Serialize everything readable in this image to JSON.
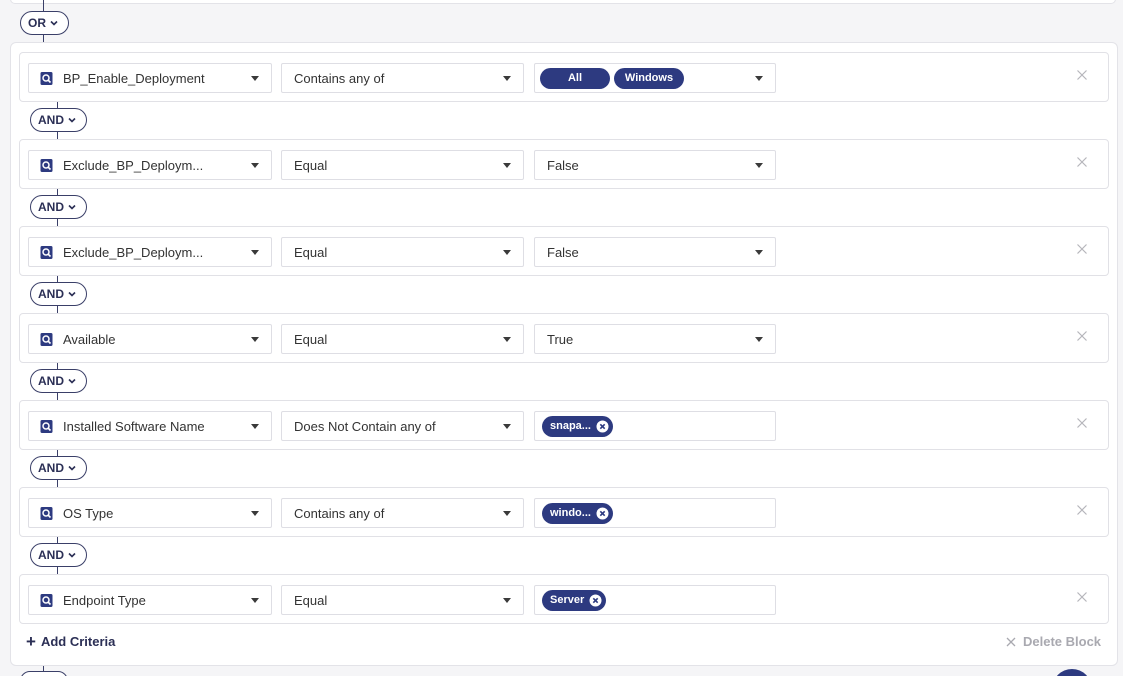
{
  "top_operator": "OR",
  "rows": [
    {
      "field": "BP_Enable_Deployment",
      "operator": "Contains any of",
      "value_type": "tags-select",
      "tags": [
        "All",
        "Windows"
      ]
    },
    {
      "join": "AND",
      "field": "Exclude_BP_Deploym...",
      "operator": "Equal",
      "value_type": "select",
      "value": "False"
    },
    {
      "join": "AND",
      "field": "Exclude_BP_Deploym...",
      "operator": "Equal",
      "value_type": "select",
      "value": "False"
    },
    {
      "join": "AND",
      "field": "Available",
      "operator": "Equal",
      "value_type": "select",
      "value": "True"
    },
    {
      "join": "AND",
      "field": "Installed Software Name",
      "operator": "Does Not Contain any of",
      "value_type": "chip",
      "chip": "snapa..."
    },
    {
      "join": "AND",
      "field": "OS Type",
      "operator": "Contains any of",
      "value_type": "chip",
      "chip": "windo..."
    },
    {
      "join": "AND",
      "field": "Endpoint Type",
      "operator": "Equal",
      "value_type": "chip",
      "chip": "Server"
    }
  ],
  "footer": {
    "add_criteria": "Add Criteria",
    "delete_block": "Delete Block"
  },
  "colors": {
    "accent": "#2d3a80",
    "chip": "#2d3a80",
    "line": "#3a3f68",
    "muted": "#a9a9b0"
  },
  "icons": {
    "field": "search-doc-icon",
    "caret": "caret-down-icon",
    "close": "close-icon",
    "chip_remove": "remove-circle-icon",
    "chevron": "chevron-down-icon"
  }
}
